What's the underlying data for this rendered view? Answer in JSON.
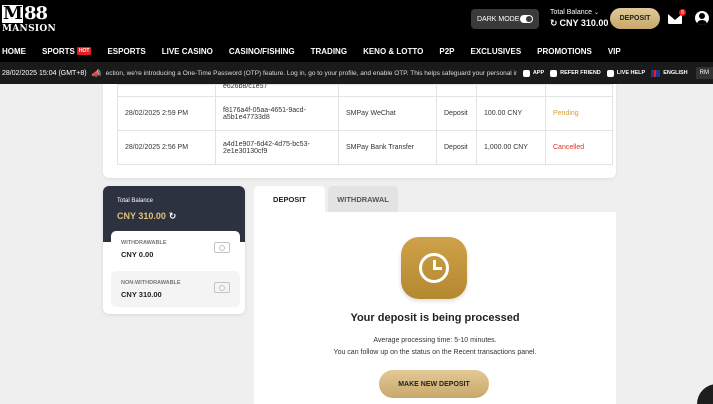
{
  "header": {
    "logo_main": "88",
    "logo_m": "M",
    "logo_sub": "MANSION",
    "dark_mode_label": "DARK MODE",
    "total_balance_label": "Total Balance",
    "total_balance_chevron": "⌄",
    "total_balance_value": "CNY 310.00",
    "refresh_glyph": "↻",
    "deposit_button": "DEPOSIT",
    "mail_badge": "8"
  },
  "nav": [
    {
      "label": "HOME"
    },
    {
      "label": "SPORTS",
      "badge": "HOT"
    },
    {
      "label": "ESPORTS"
    },
    {
      "label": "LIVE CASINO"
    },
    {
      "label": "CASINO/FISHING"
    },
    {
      "label": "TRADING"
    },
    {
      "label": "KENO & LOTTO"
    },
    {
      "label": "P2P"
    },
    {
      "label": "EXCLUSIVES"
    },
    {
      "label": "PROMOTIONS"
    },
    {
      "label": "VIP"
    }
  ],
  "ticker": {
    "datetime": "28/02/2025 15:04 (GMT+8)",
    "message": "ection, we're introducing a One-Time Password (OTP) feature. Log in, go to your profile, and enable OTP. This helps safeguard your personal informati",
    "app": "APP",
    "refer": "REFER FRIEND",
    "live_help": "LIVE HELP",
    "language": "ENGLISH",
    "rm": "RM"
  },
  "transactions": {
    "partial_row_id": "e626b8/c1e57",
    "rows": [
      {
        "date": "28/02/2025 2:59 PM",
        "id_line1": "f8176a4f-05aa-4651-9acd-",
        "id_line2": "a5b1e47733d8",
        "method": "SMPay WeChat",
        "type": "Deposit",
        "amount": "100.00 CNY",
        "status": "Pending"
      },
      {
        "date": "28/02/2025 2:56 PM",
        "id_line1": "a4d1e907-6d42-4d75-bc53-",
        "id_line2": "2e1e30130cf9",
        "method": "SMPay Bank Transfer",
        "type": "Deposit",
        "amount": "1,000.00 CNY",
        "status": "Cancelled"
      }
    ]
  },
  "balance_panel": {
    "total_label": "Total Balance",
    "total_value": "CNY 310.00",
    "withdrawable_label": "WITHDRAWABLE",
    "withdrawable_value": "CNY 0.00",
    "non_withdrawable_label": "NON-WITHDRAWABLE",
    "non_withdrawable_value": "CNY 310.00"
  },
  "tabs": {
    "deposit": "DEPOSIT",
    "withdrawal": "WITHDRAWAL"
  },
  "status_panel": {
    "title": "Your deposit is being processed",
    "line1": "Average processing time: 5-10 minutes.",
    "line2": "You can follow up on the status on the Recent transactions panel.",
    "button": "MAKE NEW DEPOSIT"
  },
  "colors": {
    "gold": "#c9a86b",
    "pending": "#d4a040",
    "cancelled": "#d9362b",
    "balance_header": "#2d3240"
  }
}
